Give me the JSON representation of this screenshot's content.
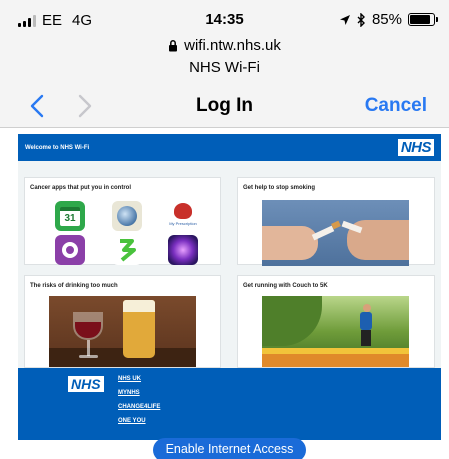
{
  "status_bar": {
    "carrier": "EE",
    "network": "4G",
    "time": "14:35",
    "battery_percent": "85%",
    "battery_level": 0.85,
    "icons": [
      "signal-icon",
      "location-arrow-icon",
      "bluetooth-icon",
      "battery-icon"
    ]
  },
  "browser": {
    "url": "wifi.ntw.nhs.uk",
    "page_title": "NHS Wi-Fi"
  },
  "nav": {
    "title": "Log In",
    "cancel_label": "Cancel"
  },
  "site": {
    "welcome": "Welcome to NHS Wi-Fi",
    "logo_text": "NHS",
    "cards": [
      {
        "title": "Cancer apps that put you in control"
      },
      {
        "title": "Get help to stop smoking"
      },
      {
        "title": "The risks of drinking too much"
      },
      {
        "title": "Get running with Couch to 5K"
      }
    ],
    "calendar_day": "31",
    "app_label": "My Prescription",
    "footer": {
      "logo_text": "NHS",
      "links": [
        "NHS UK",
        "MYNHS",
        "CHANGE4LIFE",
        "ONE YOU"
      ]
    }
  },
  "enable_button": "Enable Internet Access",
  "colors": {
    "nhs_blue": "#005eb8",
    "ios_blue": "#2979f2",
    "button_blue": "#1a6bd8"
  }
}
